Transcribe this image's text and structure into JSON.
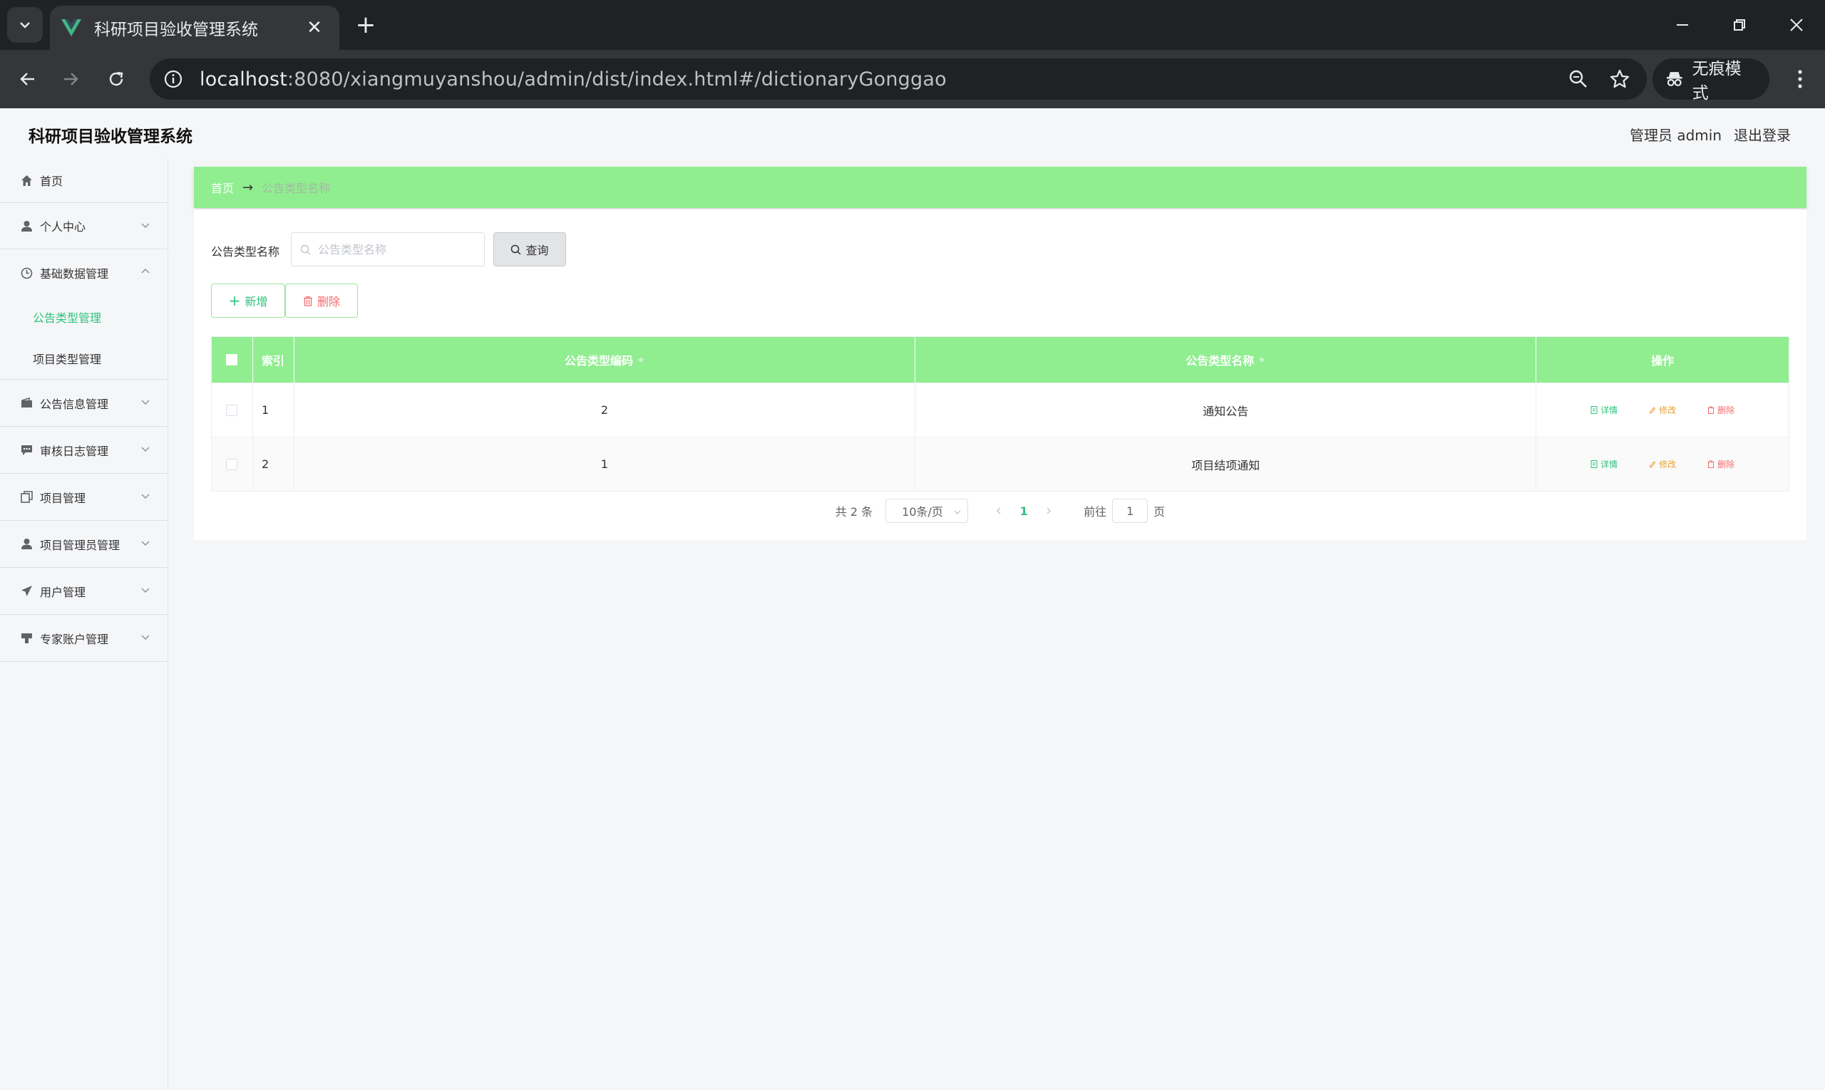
{
  "browser": {
    "tab_title": "科研项目验收管理系统",
    "tab_close": "✕",
    "new_tab": "+",
    "url_host": "localhost",
    "url_path": ":8080/xiangmuyanshou/admin/dist/index.html#/dictionaryGonggao",
    "incognito_label": "无痕模式"
  },
  "header": {
    "title": "科研项目验收管理系统",
    "user": "管理员 admin",
    "logout": "退出登录"
  },
  "sidebar": {
    "home": "首页",
    "personal": "个人中心",
    "basic": "基础数据管理",
    "basic_sub": [
      "公告类型管理",
      "项目类型管理"
    ],
    "notice": "公告信息管理",
    "audit": "审核日志管理",
    "project": "项目管理",
    "project_admin": "项目管理员管理",
    "user": "用户管理",
    "expert": "专家账户管理"
  },
  "breadcrumb": {
    "home": "首页",
    "separator": "→",
    "current": "公告类型名称"
  },
  "search": {
    "label": "公告类型名称",
    "placeholder": "公告类型名称",
    "query_button": "查询"
  },
  "actions": {
    "add": "新增",
    "delete": "删除"
  },
  "table": {
    "headers": {
      "index": "索引",
      "code": "公告类型编码",
      "name": "公告类型名称",
      "ops": "操作"
    },
    "rows": [
      {
        "index": "1",
        "code": "2",
        "name": "通知公告"
      },
      {
        "index": "2",
        "code": "1",
        "name": "项目结项通知"
      }
    ],
    "ops": {
      "detail": "详情",
      "edit": "修改",
      "delete": "删除"
    }
  },
  "pagination": {
    "total": "共 2 条",
    "page_size": "10条/页",
    "current_page": "1",
    "goto_label": "前往",
    "goto_value": "1",
    "page_unit": "页"
  },
  "colors": {
    "accent_green": "#90ee90",
    "active_text": "#2fc27c",
    "danger": "#f56c6c",
    "warning": "#e6a23c"
  }
}
